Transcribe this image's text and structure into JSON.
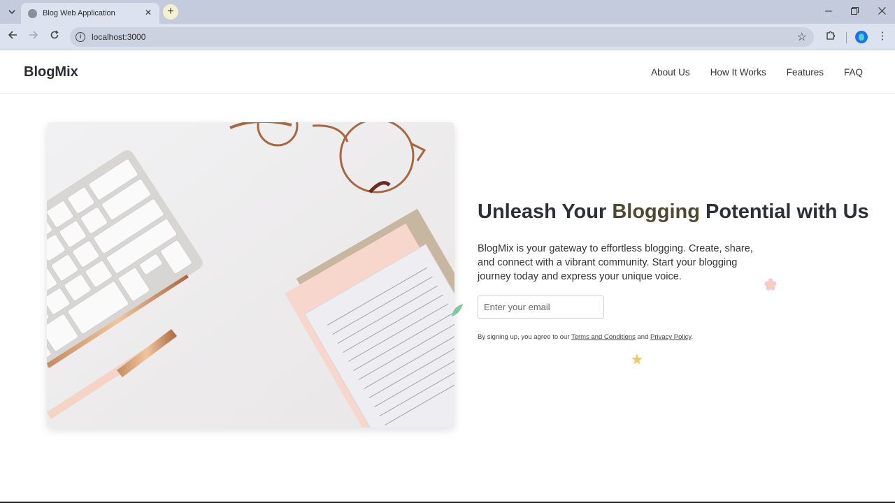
{
  "browser": {
    "tab_title": "Blog Web Application",
    "url": "localhost:3000",
    "new_tab_label": "+",
    "window_controls": [
      "minimize-icon",
      "restore-icon",
      "close-icon"
    ]
  },
  "site": {
    "brand": "BlogMix",
    "nav": [
      {
        "label": "About Us"
      },
      {
        "label": "How It Works"
      },
      {
        "label": "Features"
      },
      {
        "label": "FAQ"
      }
    ]
  },
  "hero": {
    "headline_pre": "Unleash Your ",
    "headline_accent": "Blogging",
    "headline_post": " Potential with Us",
    "description": "BlogMix is your gateway to effortless blogging. Create, share, and connect with a vibrant community. Start your blogging journey today and express your unique voice.",
    "email_placeholder": "Enter your email",
    "legal_pre": "By signing up, you agree to our ",
    "terms_link": "Terms and Conditions",
    "legal_mid": " and ",
    "privacy_link": "Privacy Policy",
    "legal_post": ".",
    "image": "desk-flatlay-keyboard-glasses-pens-notebook"
  },
  "colors": {
    "accent": "#4c4a30",
    "heading": "#2b2f36",
    "chrome_bg": "#c3cbdc",
    "toolbar_bg": "#dde3ee"
  }
}
